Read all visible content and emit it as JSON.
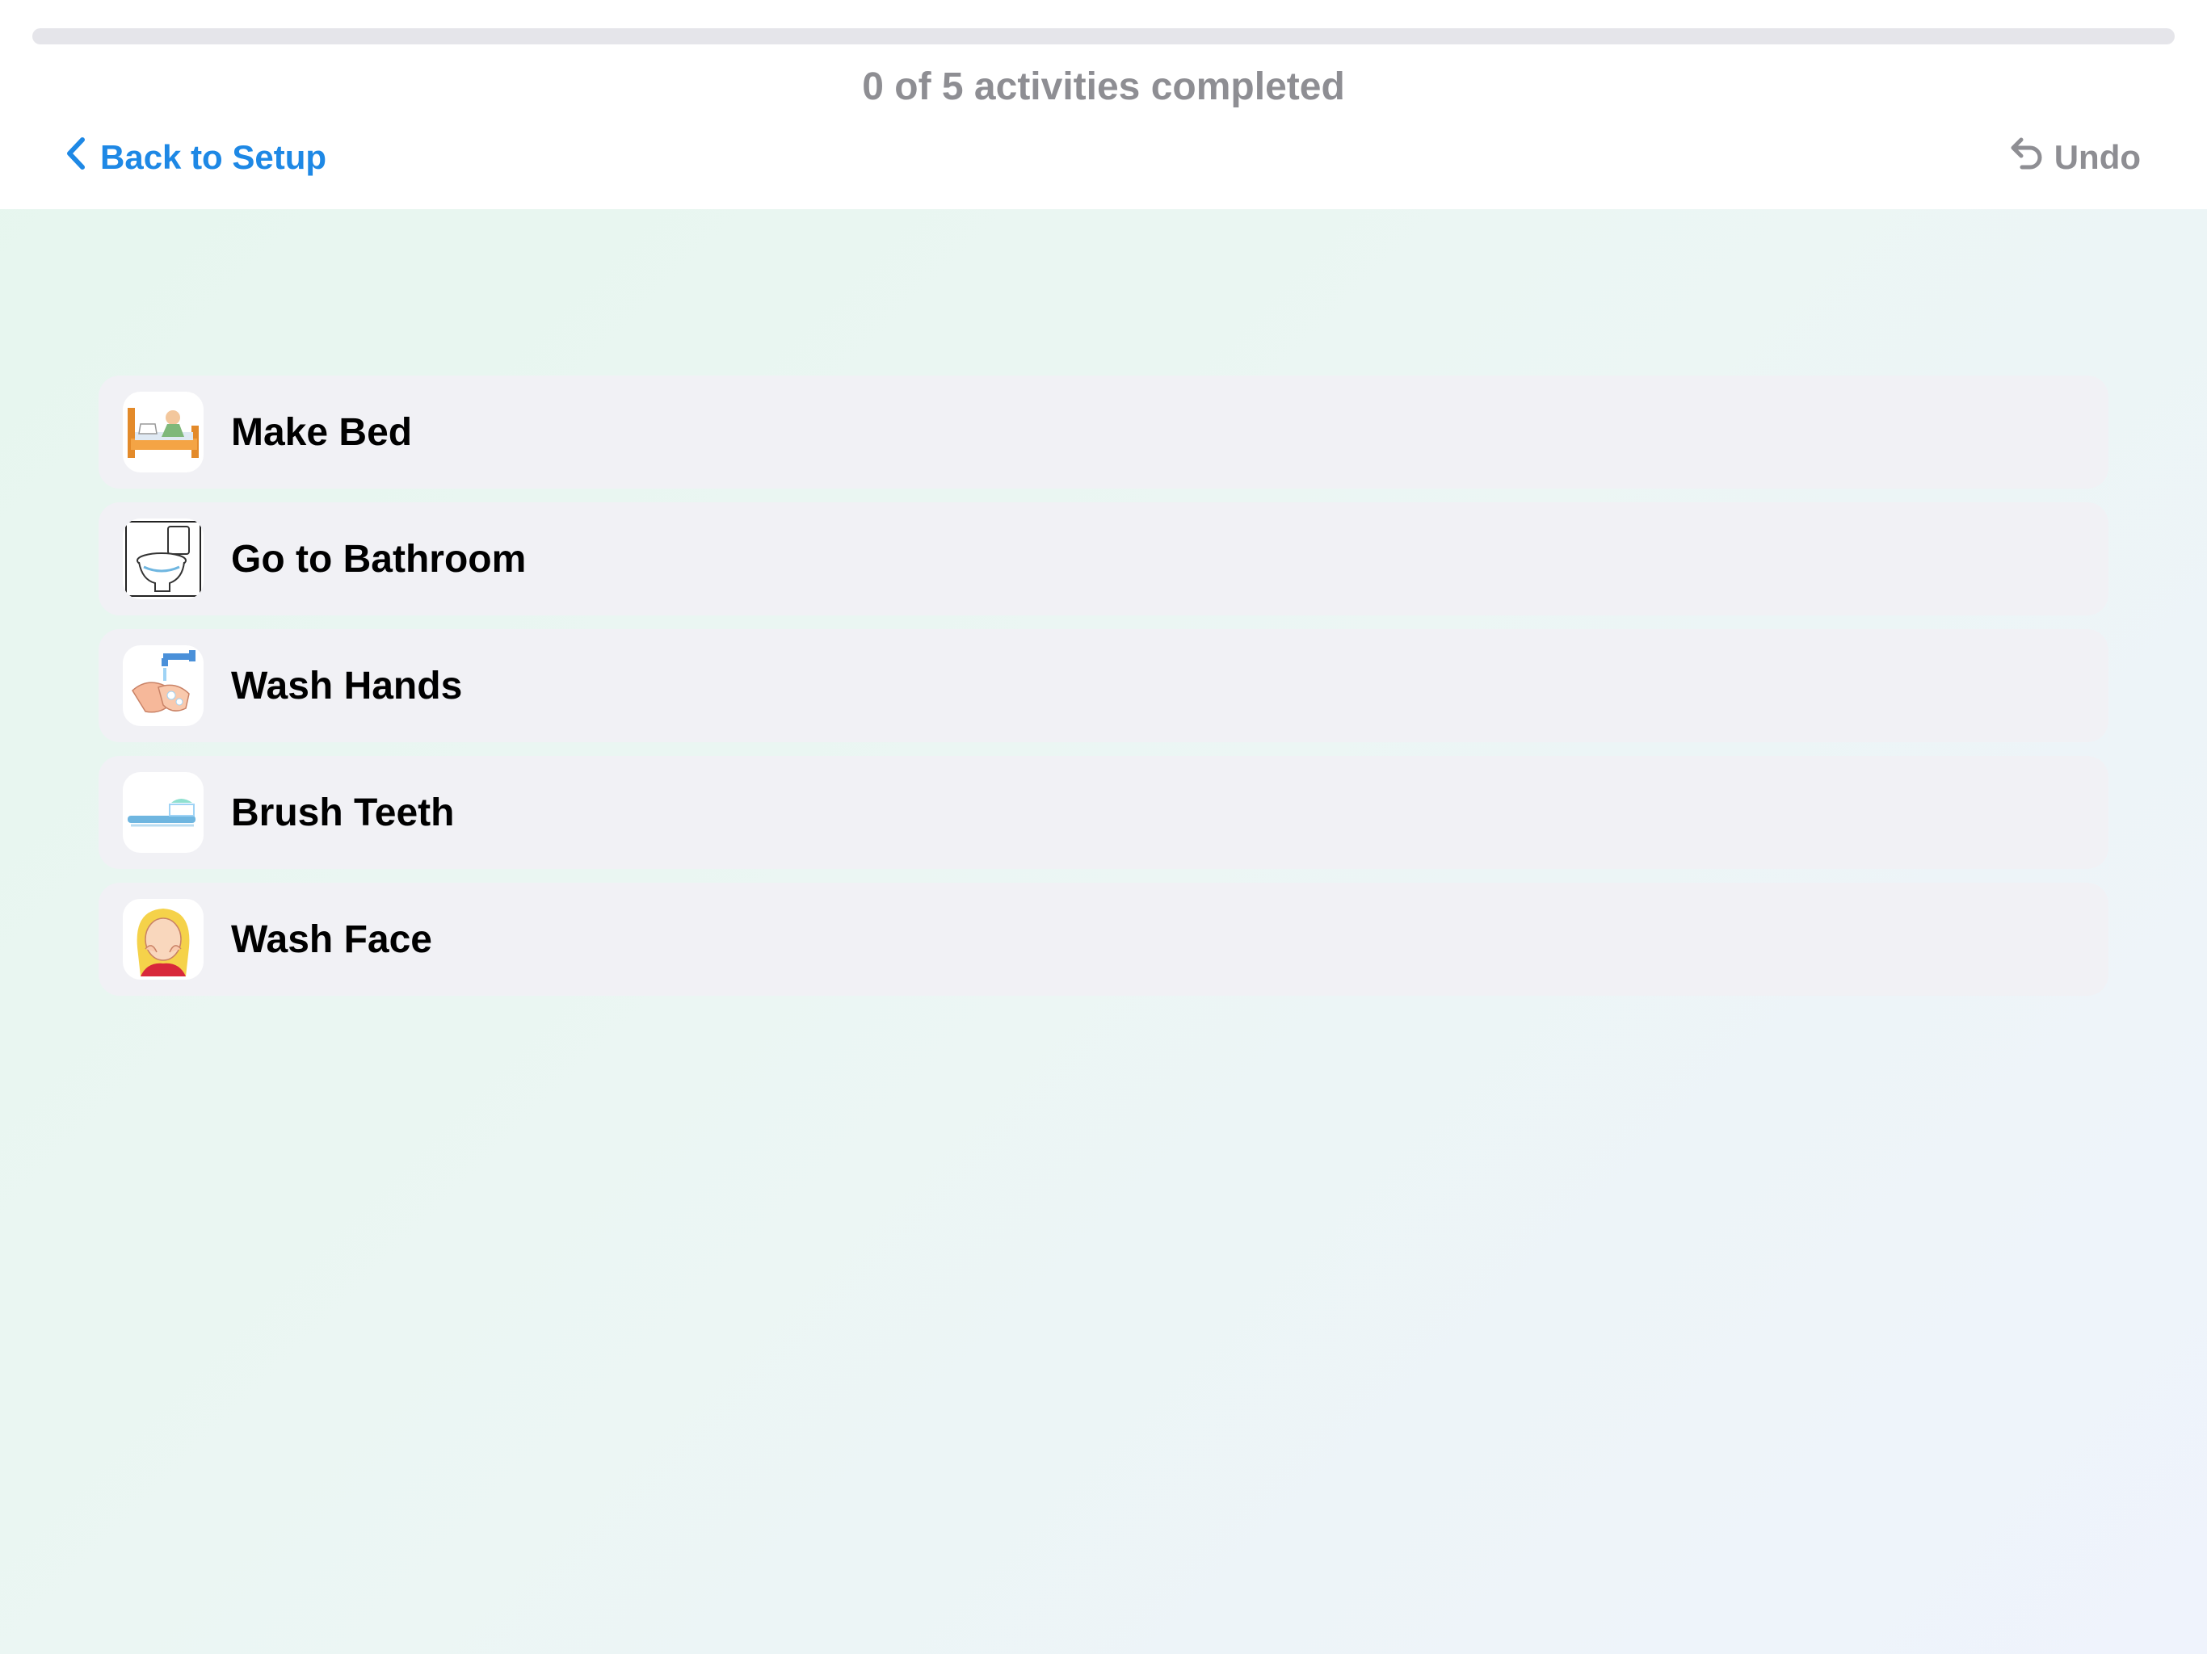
{
  "header": {
    "progress_text": "0 of 5 activities completed",
    "progress_fraction": 0,
    "back_label": "Back to Setup",
    "undo_label": "Undo"
  },
  "activities": [
    {
      "label": "Make Bed",
      "icon": "make-bed-icon"
    },
    {
      "label": "Go to Bathroom",
      "icon": "toilet-icon"
    },
    {
      "label": "Wash Hands",
      "icon": "wash-hands-icon"
    },
    {
      "label": "Brush Teeth",
      "icon": "toothbrush-icon"
    },
    {
      "label": "Wash Face",
      "icon": "wash-face-icon"
    }
  ],
  "colors": {
    "accent": "#1e88e5",
    "muted": "#8e8e93",
    "row_background": "#f1f1f5",
    "progress_track": "#e5e5ea"
  }
}
